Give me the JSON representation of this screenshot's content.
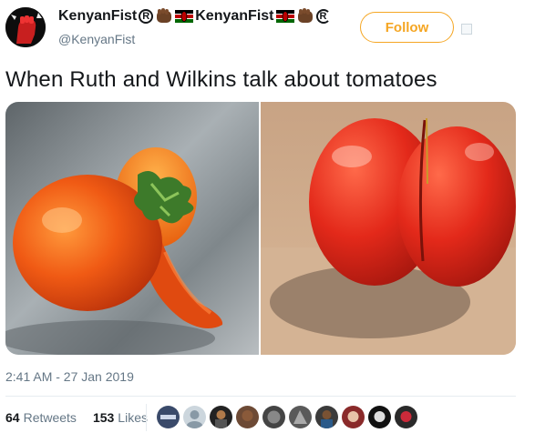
{
  "tweet": {
    "display_name": "KenyanFist",
    "display_name_repeat": "KenyanFist",
    "registered_mark": "R",
    "handle": "@KenyanFist",
    "follow_label": "Follow",
    "text": "When Ruth and Wilkins talk about tomatoes",
    "timestamp": "2:41 AM - 27 Jan 2019",
    "retweets_count": "64",
    "retweets_label": "Retweets",
    "likes_count": "153",
    "likes_label": "Likes"
  },
  "colors": {
    "accent": "#f5a623",
    "secondary_text": "#657786",
    "divider": "#e6ecf0"
  },
  "icons": [
    "registered-icon",
    "raised-fist-icon",
    "kenya-flag-icon",
    "dropdown-caret-icon"
  ],
  "media": [
    "tomato-with-stem-image",
    "tomato-backside-image"
  ],
  "likers_count_shown": 10
}
